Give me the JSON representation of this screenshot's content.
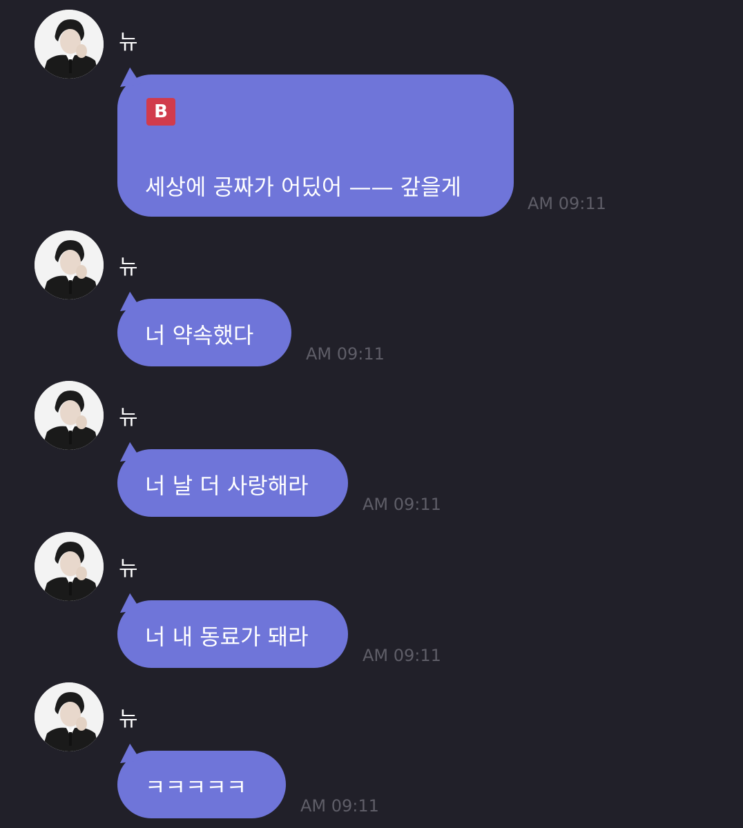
{
  "chat": {
    "messages": [
      {
        "sender": "뉴",
        "badge": "B",
        "text": "세상에 공짜가 어딨어 —— 갚을게",
        "time": "AM 09:11"
      },
      {
        "sender": "뉴",
        "text": "너 약속했다",
        "time": "AM 09:11"
      },
      {
        "sender": "뉴",
        "text": "너 날 더 사랑해라",
        "time": "AM 09:11"
      },
      {
        "sender": "뉴",
        "text": "너 내 동료가 돼라",
        "time": "AM 09:11"
      },
      {
        "sender": "뉴",
        "text": "ㅋㅋㅋㅋㅋ",
        "time": "AM 09:11"
      }
    ]
  },
  "colors": {
    "background": "#212029",
    "bubble": "#6f75d9",
    "badge": "#d13b4c",
    "timestamp": "#5f5e68"
  },
  "icons": {
    "avatar": "profile-photo",
    "badge": "b-letter-badge-icon"
  }
}
